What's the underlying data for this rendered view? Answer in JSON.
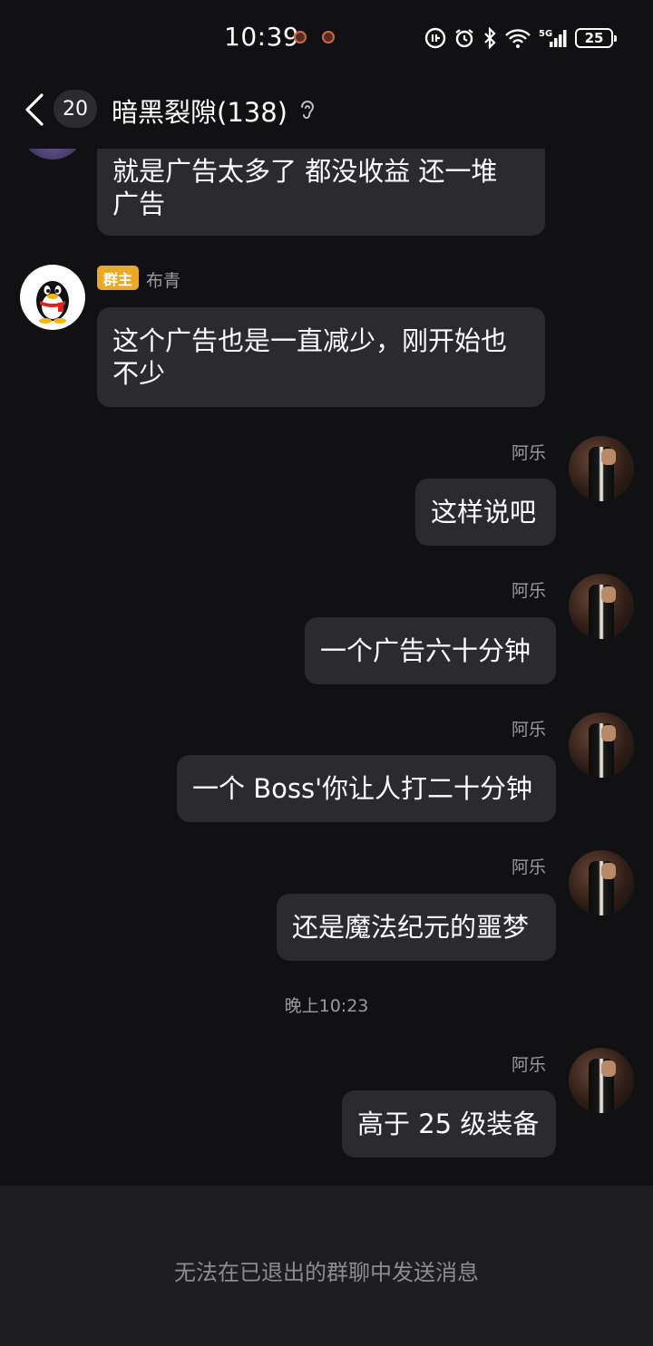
{
  "status_bar": {
    "time": "10:39",
    "network": "5G",
    "battery": "25"
  },
  "header": {
    "unread_count": "20",
    "title": "暗黑裂隙(138)"
  },
  "messages": [
    {
      "text_lines": [
        "就是广告太多了 都没收益 还一堆",
        "广告"
      ]
    },
    {
      "sender": "布青",
      "role_tag": "群主",
      "text_lines": [
        "这个广告也是一直减少，刚开始也",
        "不少"
      ]
    },
    {
      "sender": "阿乐",
      "text": "这样说吧"
    },
    {
      "sender": "阿乐",
      "text": "一个广告六十分钟"
    },
    {
      "sender": "阿乐",
      "text": "一个 Boss'你让人打二十分钟"
    },
    {
      "sender": "阿乐",
      "text": "还是魔法纪元的噩梦"
    },
    {
      "sender": "阿乐",
      "text": "高于 25 级装备"
    }
  ],
  "time_divider": "晚上10:23",
  "bottom_notice": "无法在已退出的群聊中发送消息",
  "colors": {
    "background": "#111114",
    "bubble": "#2b2b2f",
    "owner_tag": "#e8a92a",
    "bottom_bar": "#1e1e22"
  }
}
